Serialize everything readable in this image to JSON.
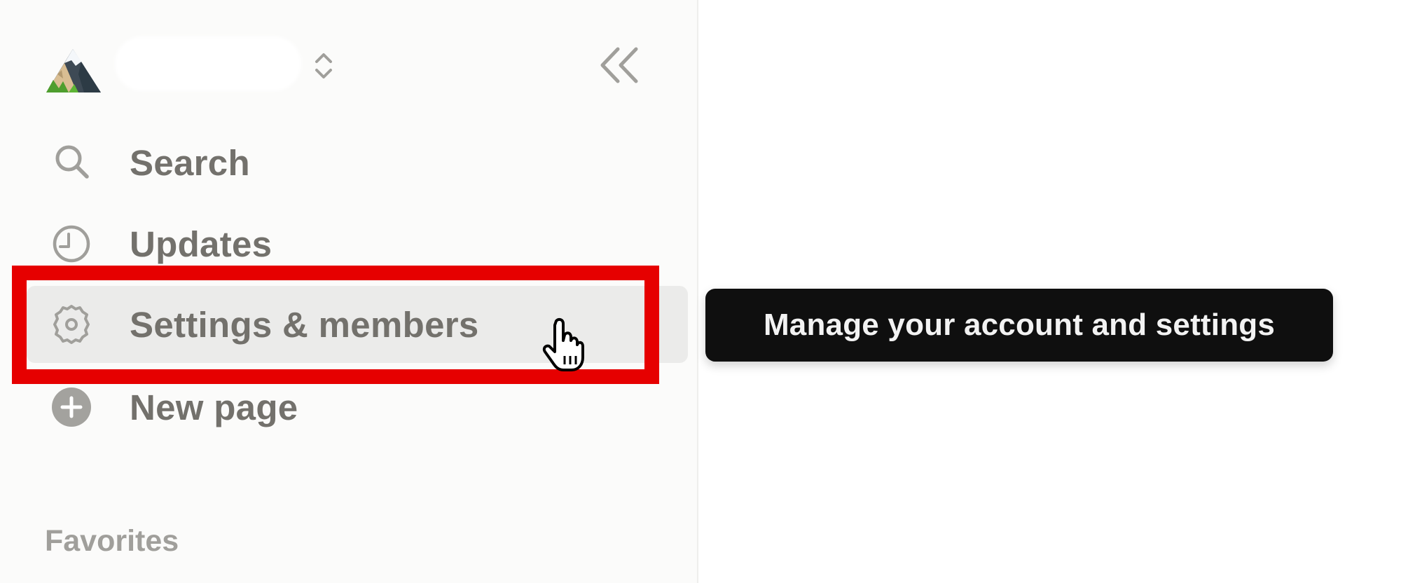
{
  "sidebar": {
    "workspace": {
      "icon": "snow-capped-mountain-emoji",
      "name_redacted": true,
      "switcher_icon": "chevron-up-down-icon"
    },
    "collapse_icon": "double-chevron-left-icon",
    "items": [
      {
        "label": "Search",
        "icon": "search-icon"
      },
      {
        "label": "Updates",
        "icon": "clock-icon"
      },
      {
        "label": "Settings & members",
        "icon": "gear-icon",
        "state": "hovered"
      },
      {
        "label": "New page",
        "icon": "plus-circle-icon"
      }
    ],
    "sections": [
      {
        "label": "Favorites"
      }
    ]
  },
  "tooltip": {
    "text": "Manage your account and settings"
  },
  "annotation": {
    "target": "Settings & members",
    "color": "#E60000"
  },
  "colors": {
    "sidebar_bg": "#FBFBFA",
    "text": "#73716C",
    "muted": "#A09F9B",
    "hover_bg": "#EBEBEA",
    "tooltip_bg": "#0F0F0F",
    "highlight": "#E60000"
  }
}
